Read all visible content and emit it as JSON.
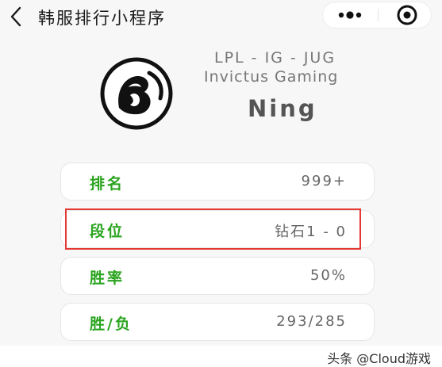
{
  "nav": {
    "title": "韩服排行小程序",
    "back_icon": "chevron-left-icon",
    "more_icon": "more-dots-icon",
    "close_icon": "target-close-icon"
  },
  "profile": {
    "line1": "LPL - IG - JUG",
    "line2": "Invictus Gaming",
    "player_name": "Ning",
    "logo_icon": "invictus-gaming-logo"
  },
  "stats": [
    {
      "label": "排名",
      "value": "999+"
    },
    {
      "label": "段位",
      "value": "钻石1 - 0",
      "highlighted": true
    },
    {
      "label": "胜率",
      "value": "50%"
    },
    {
      "label": "胜/负",
      "value": "293/285"
    }
  ],
  "watermark": "头条 @Cloud游戏",
  "colors": {
    "label_green": "#2aa41f",
    "highlight_red": "#e53935",
    "background": "#f7f7f7"
  }
}
